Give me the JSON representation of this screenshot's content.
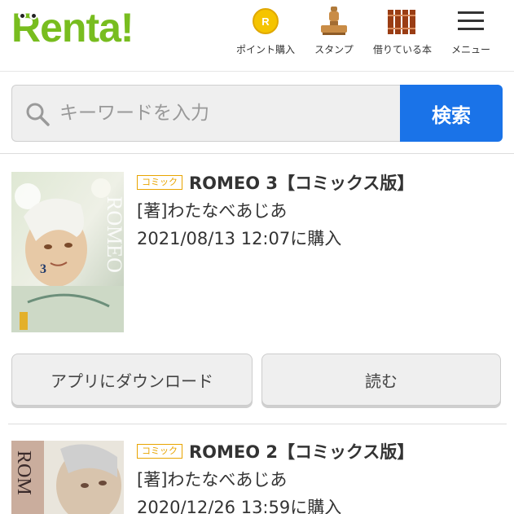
{
  "header": {
    "logo_text": "Renta!",
    "nav": [
      {
        "label": "ポイント購入",
        "icon": "coin-icon",
        "coin_letter": "R"
      },
      {
        "label": "スタンプ",
        "icon": "stamp-icon"
      },
      {
        "label": "借りている本",
        "icon": "books-icon"
      },
      {
        "label": "メニュー",
        "icon": "hamburger-menu-icon"
      }
    ]
  },
  "search": {
    "placeholder": "キーワードを入力",
    "button_label": "検索"
  },
  "items": [
    {
      "badge": "コミック",
      "title": "ROMEO 3【コミックス版】",
      "author": "[著]わたなべあじあ",
      "purchased": "2021/08/13 12:07に購入",
      "cover_text": "ROMEO",
      "cover_volume": "3",
      "buttons": {
        "download": "アプリにダウンロード",
        "read": "読む"
      }
    },
    {
      "badge": "コミック",
      "title": "ROMEO 2【コミックス版】",
      "author": "[著]わたなべあじあ",
      "purchased": "2020/12/26 13:59に購入",
      "cover_text": "ROM"
    }
  ],
  "colors": {
    "brand_green": "#78bd1f",
    "search_blue": "#1a73e8",
    "badge_orange": "#e8a400"
  }
}
